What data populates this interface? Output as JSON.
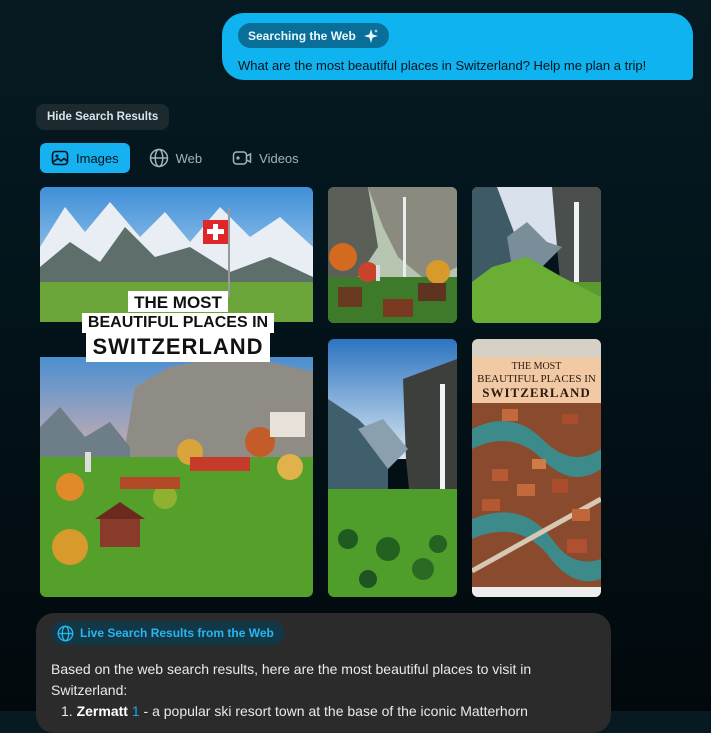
{
  "user_message": {
    "chip_label": "Searching the Web",
    "chip_icon": "sparkle-icon",
    "text": "What are the most beautiful places in Switzerland? Help me plan a trip!"
  },
  "hide_button_label": "Hide Search Results",
  "tabs": [
    {
      "label": "Images",
      "icon": "image-icon",
      "active": true
    },
    {
      "label": "Web",
      "icon": "globe-icon",
      "active": false
    },
    {
      "label": "Videos",
      "icon": "video-icon",
      "active": false
    }
  ],
  "images": {
    "large": {
      "line1": "THE MOST",
      "line2": "BEAUTIFUL PLACES IN",
      "line3": "SWITZERLAND"
    },
    "pin": {
      "line1": "THE MOST",
      "line2": "BEAUTIFUL PLACES IN",
      "line3": "SWITZERLAND"
    }
  },
  "answer": {
    "chip_label": "Live Search Results from the Web",
    "intro": "Based on the web search results, here are the most beautiful places to visit in Switzerland:",
    "item_number": "1.",
    "item_name": "Zermatt",
    "item_cite": "1",
    "item_text": " - a popular ski resort town at the base of the iconic Matterhorn"
  },
  "colors": {
    "accent": "#0fb3f0",
    "background": "#03141b",
    "answer_bg": "#2b2b2b"
  }
}
